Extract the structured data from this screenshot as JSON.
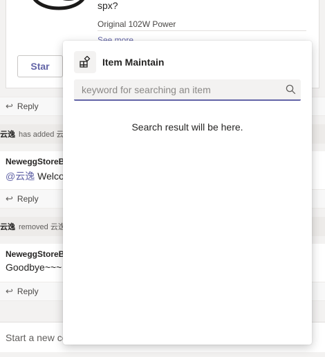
{
  "card": {
    "title": "spx?",
    "subtitle": "Original 102W Power",
    "see_more": "See more",
    "star_label": "Star"
  },
  "thread": {
    "reply_label": "Reply",
    "system_added": {
      "actor": "云逸",
      "text": "has added 云逸"
    },
    "message_welcome": {
      "sender": "NeweggStoreBot",
      "mention": "@云逸",
      "text": " Welcome"
    },
    "system_removed": {
      "actor": "云逸",
      "text": "removed 云逸"
    },
    "message_goodbye": {
      "sender": "NeweggStoreBot",
      "text": "Goodbye~~~"
    }
  },
  "compose": {
    "placeholder": "Start a new conversation"
  },
  "panel": {
    "title": "Item Maintain",
    "search_placeholder": "keyword for searching an item",
    "search_value": "",
    "result_text": "Search result will be here."
  },
  "colors": {
    "accent": "#6264a7",
    "panel_bg": "#ffffff",
    "page_bg": "#f3f2f1"
  },
  "icons": {
    "app": "app-grid-icon",
    "search": "search-icon",
    "reply": "reply-arrow-icon"
  }
}
